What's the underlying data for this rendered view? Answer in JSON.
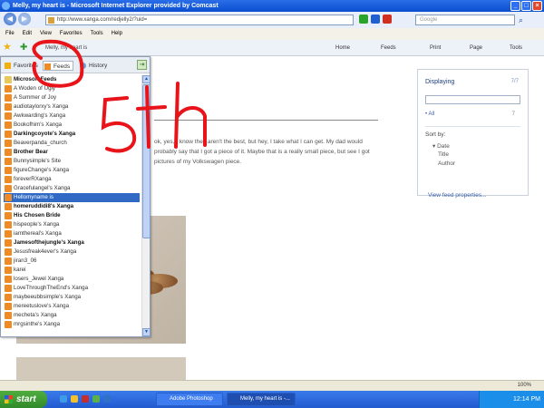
{
  "window": {
    "title": "Melly, my heart is - Microsoft Internet Explorer provided by Comcast"
  },
  "nav": {
    "address": "http://www.xanga.com/redjelly2/?uid=",
    "search_placeholder": "Google"
  },
  "menu": [
    "File",
    "Edit",
    "View",
    "Favorites",
    "Tools",
    "Help"
  ],
  "favbar": {
    "tab_label": "Melly, my heart is",
    "home": "Home",
    "feeds": "Feeds",
    "print": "Print",
    "page": "Page",
    "tools": "Tools"
  },
  "sidebar": {
    "tabs": {
      "favorites": "Favorites",
      "feeds": "Feeds",
      "history": "History"
    },
    "items": [
      {
        "label": "Microsoft Feeds",
        "type": "folder",
        "bold": true
      },
      {
        "label": "A Woden of Ugly",
        "type": "feed"
      },
      {
        "label": "A Summer of Joy",
        "type": "feed"
      },
      {
        "label": "audiotaylorxy's Xanga",
        "type": "feed"
      },
      {
        "label": "Awkwarding's Xanga",
        "type": "feed"
      },
      {
        "label": "Bookofhim's Xanga",
        "type": "feed"
      },
      {
        "label": "Darkingcoyote's Xanga",
        "type": "feed",
        "bold": true
      },
      {
        "label": "Beaverpanda_church",
        "type": "feed"
      },
      {
        "label": "Brother Bear",
        "type": "feed",
        "bold": true
      },
      {
        "label": "Bunnysimple's Site",
        "type": "feed"
      },
      {
        "label": "figureChange's Xanga",
        "type": "feed"
      },
      {
        "label": "foreverRXanga",
        "type": "feed"
      },
      {
        "label": "Gracefulangel's Xanga",
        "type": "feed"
      },
      {
        "label": "Hellomyname is",
        "type": "feed",
        "selected": true
      },
      {
        "label": "homeruddidi8's Xanga",
        "type": "feed",
        "bold": true
      },
      {
        "label": "His Chosen Bride",
        "type": "feed",
        "bold": true
      },
      {
        "label": "hispeople's Xanga",
        "type": "feed"
      },
      {
        "label": "iamthereal's Xanga",
        "type": "feed"
      },
      {
        "label": "Jamesofthejungle's Xanga",
        "type": "feed",
        "bold": true
      },
      {
        "label": "Jesusfreak4ever's Xanga",
        "type": "feed"
      },
      {
        "label": "jiran3_06",
        "type": "feed"
      },
      {
        "label": "karei",
        "type": "feed"
      },
      {
        "label": "losers_Jewel Xanga",
        "type": "feed"
      },
      {
        "label": "LoveThroughTheEnd's Xanga",
        "type": "feed"
      },
      {
        "label": "maybeeubbsimple's Xanga",
        "type": "feed"
      },
      {
        "label": "mereetuslove's Xanga",
        "type": "feed"
      },
      {
        "label": "mecheta's Xanga",
        "type": "feed"
      },
      {
        "label": "mrgsinthe's Xanga",
        "type": "feed"
      }
    ]
  },
  "article": {
    "text": "ok, yes, I know they aren't the best, but hey, I take what I can get. My dad would probably say that I got a piece of it. Maybe that is a really small piece, but see I got pictures of my Volkswagen piece."
  },
  "feed_panel": {
    "title": "Displaying",
    "count": "7/7",
    "all_label": "All",
    "all_count": "7",
    "sort_label": "Sort by:",
    "sort_options": [
      "Date",
      "Title",
      "Author"
    ],
    "view_props": "View feed properties..."
  },
  "status": {
    "zoom": "100%"
  },
  "taskbar": {
    "start": "start",
    "tasks": [
      "Adobe Photoshop",
      "Melly, my heart is -..."
    ],
    "clock": "12:14 PM"
  },
  "annotation": {
    "text": "5th"
  },
  "colors": {
    "annotation": "#e8141a",
    "selection": "#316ac5",
    "feed_icon": "#f08a24"
  }
}
